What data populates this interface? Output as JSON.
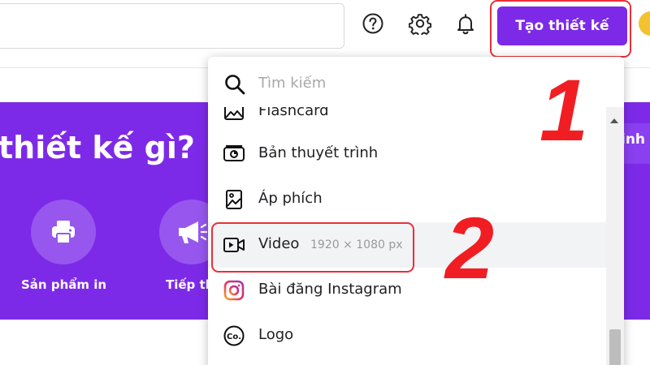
{
  "header": {
    "help_icon": "help-circle-icon",
    "settings_icon": "gear-icon",
    "notifications_icon": "bell-icon",
    "create_button_label": "Tạo thiết kế"
  },
  "hero": {
    "title": "thiết kế gì?",
    "right_partial": "inh",
    "categories": [
      {
        "label": "Sản phẩm in",
        "icon": "printer-icon"
      },
      {
        "label": "Tiếp th",
        "icon": "megaphone-icon"
      }
    ]
  },
  "dropdown": {
    "search_placeholder": "Tìm kiếm",
    "items": [
      {
        "label": "Flashcard",
        "icon": "flashcard-icon"
      },
      {
        "label": "Bản thuyết trình",
        "icon": "presentation-icon"
      },
      {
        "label": "Áp phích",
        "icon": "poster-icon"
      },
      {
        "label": "Video",
        "dims": "1920 × 1080 px",
        "icon": "video-icon"
      },
      {
        "label": "Bài đăng Instagram",
        "icon": "instagram-icon"
      },
      {
        "label": "Logo",
        "icon": "logo-icon"
      }
    ]
  },
  "annotations": {
    "step1": "1",
    "step2": "2"
  },
  "colors": {
    "brand_purple": "#7d2ae8",
    "annotation_red": "#f01e23"
  }
}
